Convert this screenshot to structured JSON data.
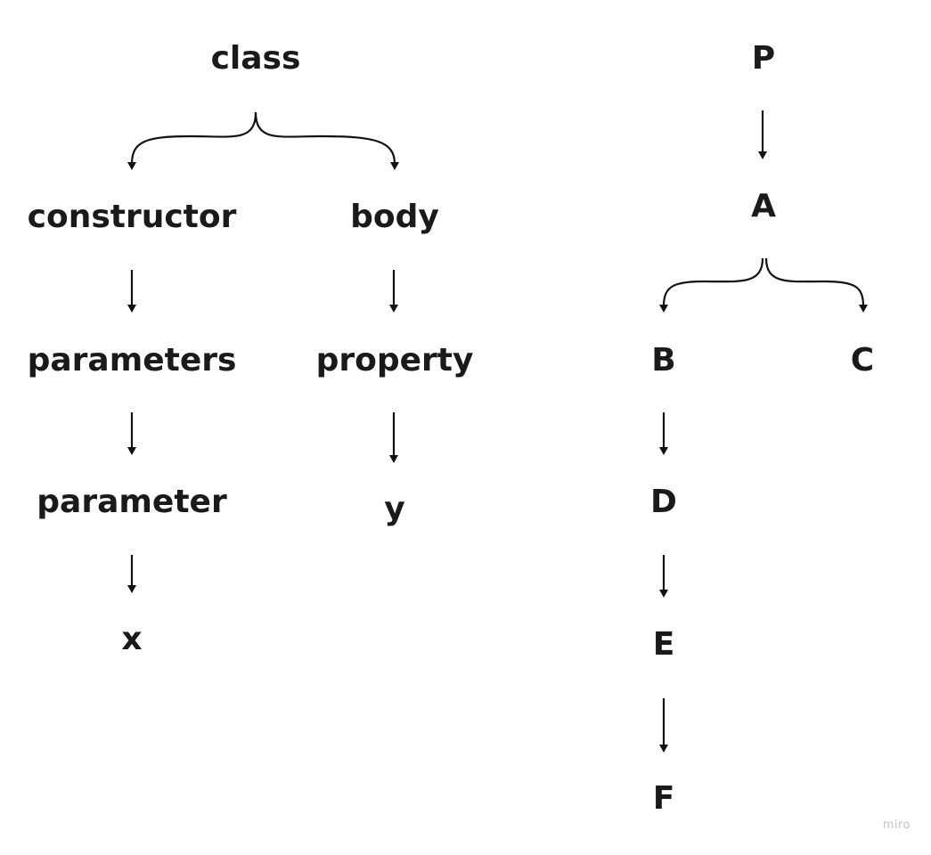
{
  "diagram": {
    "left_tree": {
      "root": "class",
      "constructor": "constructor",
      "body": "body",
      "parameters": "parameters",
      "property": "property",
      "parameter": "parameter",
      "x": "x",
      "y": "y"
    },
    "right_tree": {
      "p": "P",
      "a": "A",
      "b": "B",
      "c": "C",
      "d": "D",
      "e": "E",
      "f": "F"
    },
    "edges": [
      {
        "from": "class",
        "to": "constructor",
        "style": "brace"
      },
      {
        "from": "class",
        "to": "body",
        "style": "brace"
      },
      {
        "from": "constructor",
        "to": "parameters",
        "style": "arrow"
      },
      {
        "from": "parameters",
        "to": "parameter",
        "style": "arrow"
      },
      {
        "from": "parameter",
        "to": "x",
        "style": "arrow"
      },
      {
        "from": "body",
        "to": "property",
        "style": "arrow"
      },
      {
        "from": "property",
        "to": "y",
        "style": "arrow"
      },
      {
        "from": "P",
        "to": "A",
        "style": "arrow"
      },
      {
        "from": "A",
        "to": "B",
        "style": "brace"
      },
      {
        "from": "A",
        "to": "C",
        "style": "brace"
      },
      {
        "from": "B",
        "to": "D",
        "style": "arrow"
      },
      {
        "from": "D",
        "to": "E",
        "style": "arrow"
      },
      {
        "from": "E",
        "to": "F",
        "style": "arrow"
      }
    ]
  },
  "watermark": "miro"
}
